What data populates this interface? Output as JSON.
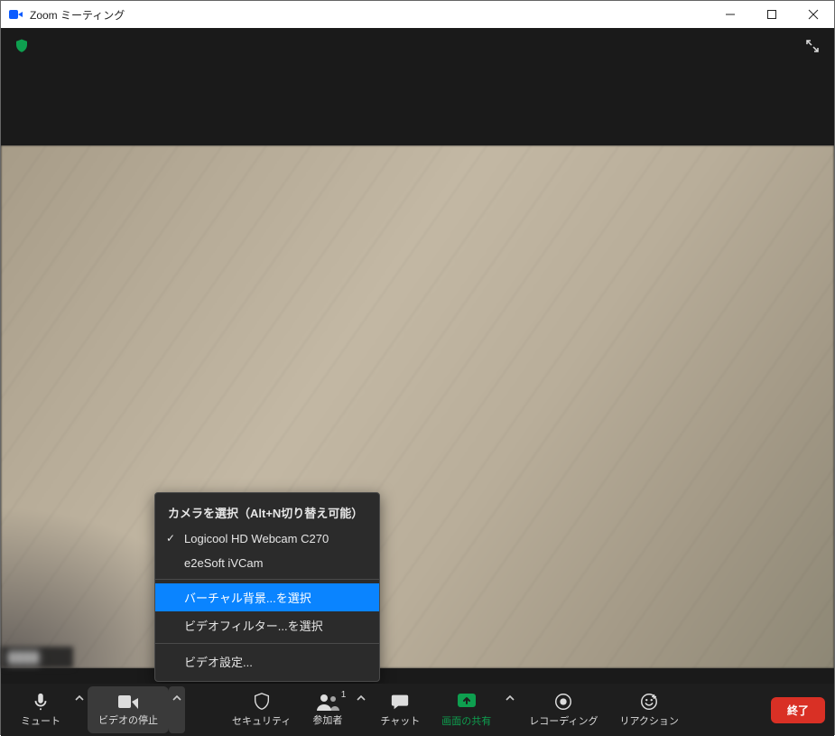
{
  "window": {
    "title": "Zoom ミーティング"
  },
  "controls": {
    "mute": "ミュート",
    "video": "ビデオの停止",
    "security": "セキュリティ",
    "participants": "参加者",
    "participants_count": "1",
    "chat": "チャット",
    "share": "画面の共有",
    "record": "レコーディング",
    "reactions": "リアクション",
    "end": "終了"
  },
  "menu": {
    "section": "カメラを選択（Alt+N切り替え可能）",
    "camera1": "Logicool HD Webcam C270",
    "camera2": "e2eSoft iVCam",
    "virtual_bg": "バーチャル背景...を選択",
    "video_filter": "ビデオフィルター...を選択",
    "video_settings": "ビデオ設定..."
  },
  "name_tag": "████"
}
